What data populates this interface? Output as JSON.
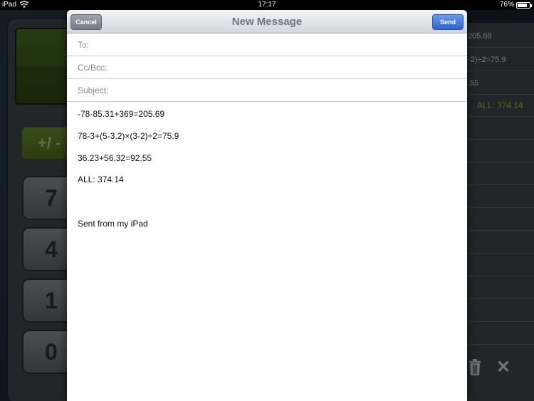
{
  "status_bar": {
    "device": "iPad",
    "time": "17:17",
    "battery_percent": "76%",
    "icons": [
      "wifi-icon",
      "battery-icon"
    ]
  },
  "background_app": {
    "calculator": {
      "sign_key": "+/ -",
      "keys": [
        "7",
        "4",
        "1",
        "0"
      ]
    },
    "history": {
      "rows": [
        "205.69",
        "-2)÷2=75.9",
        ".55",
        "ALL: 374.14"
      ]
    },
    "icons": [
      "trash-icon",
      "close-icon"
    ]
  },
  "compose": {
    "title": "New Message",
    "cancel_label": "Cancel",
    "send_label": "Send",
    "fields": {
      "to_label": "To:",
      "to_value": "",
      "cc_label": "Cc/Bcc:",
      "cc_value": "",
      "subject_label": "Subject:",
      "subject_value": ""
    },
    "body": {
      "line1": "-78-85.31+369=205.69",
      "line2": "78-3+(5-3.2)×(3-2)÷2=75.9",
      "line3": "36.23+56.32=92.55",
      "line4": "ALL: 374.14",
      "signature": "Sent from my iPad"
    }
  },
  "colors": {
    "send_button": "#2e63d2",
    "cancel_button": "#747b82",
    "calculator_accent": "#4d6e1a",
    "history_total": "#b6b22a"
  }
}
